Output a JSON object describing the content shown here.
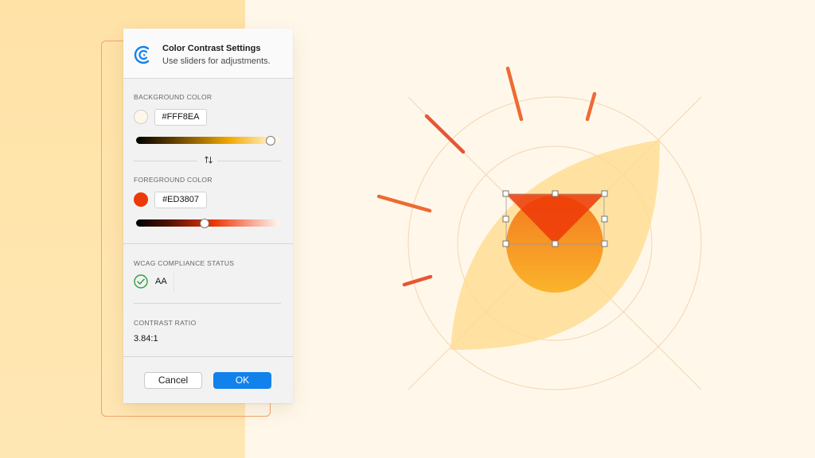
{
  "dialog": {
    "title": "Color Contrast Settings",
    "subtitle": "Use sliders for adjustments."
  },
  "background_color": {
    "label": "BACKGROUND COLOR",
    "hex": "#FFF8EA",
    "slider_value": 0.94
  },
  "foreground_color": {
    "label": "FOREGROUND COLOR",
    "hex": "#ED3807",
    "slider_value": 0.48
  },
  "swap_icon": "swap-vertical-arrows-icon",
  "compliance": {
    "label": "WCAG COMPLIANCE STATUS",
    "icon": "check-circle-icon",
    "level": "AA",
    "status_color": "#2EA043"
  },
  "contrast": {
    "label": "CONTRAST RATIO",
    "value": "3.84:1"
  },
  "buttons": {
    "cancel": "Cancel",
    "ok": "OK"
  },
  "colors": {
    "accent": "#1281EB",
    "frame_outline": "#F5A36A",
    "illustration_orange": "#F0622F",
    "illustration_yellow": "#FFD36E"
  }
}
